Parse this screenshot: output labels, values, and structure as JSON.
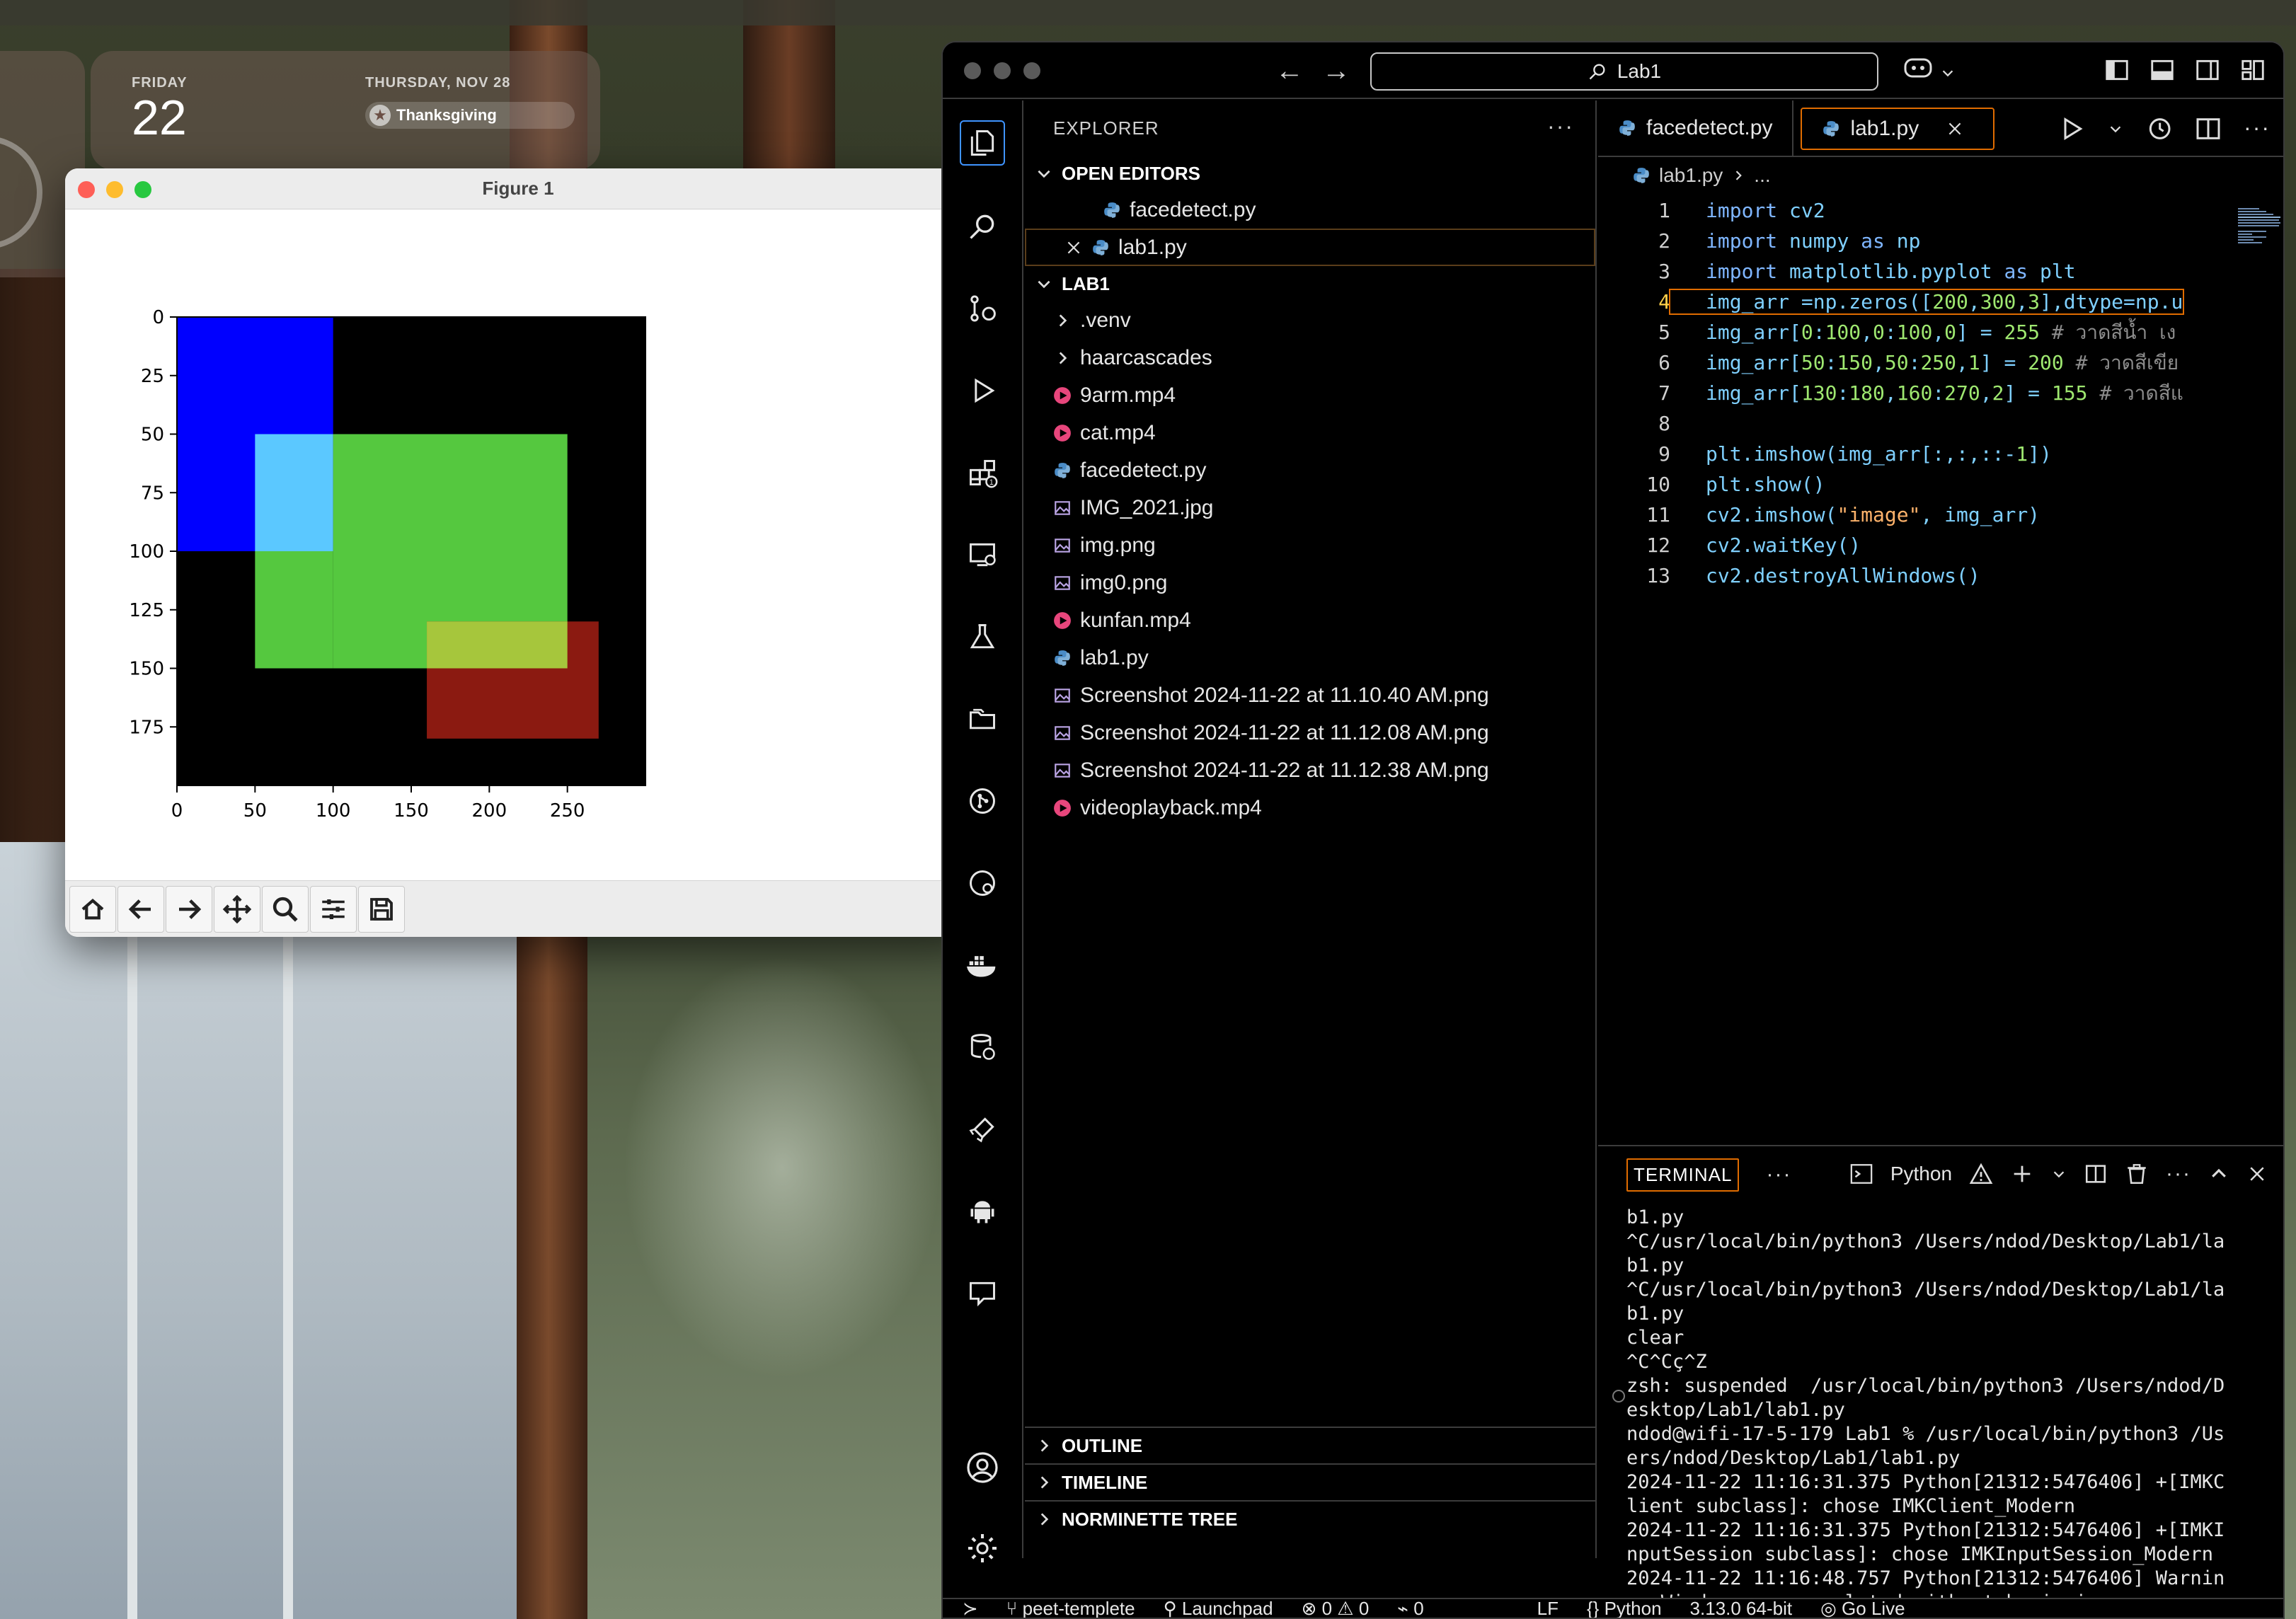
{
  "widget": {
    "day_name": "FRIDAY",
    "day_number": "22",
    "next_date": "THURSDAY, NOV 28",
    "event": "Thanksgiving"
  },
  "figure": {
    "title": "Figure 1",
    "chart_data": {
      "type": "heatmap",
      "title": "",
      "xlabel": "",
      "ylabel": "",
      "xlim": [
        0,
        300
      ],
      "ylim": [
        200,
        0
      ],
      "x_ticks": [
        "0",
        "50",
        "100",
        "150",
        "200",
        "250"
      ],
      "y_ticks": [
        "0",
        "25",
        "50",
        "75",
        "100",
        "125",
        "150",
        "175"
      ],
      "background": "#000000",
      "regions": [
        {
          "x": [
            0,
            100
          ],
          "y": [
            0,
            100
          ],
          "color": "#0000ff"
        },
        {
          "x": [
            50,
            100
          ],
          "y": [
            50,
            100
          ],
          "color": "#5bc8ff"
        },
        {
          "x": [
            100,
            250
          ],
          "y": [
            50,
            150
          ],
          "color": "#55c83f"
        },
        {
          "x": [
            50,
            100
          ],
          "y": [
            100,
            150
          ],
          "color": "#55c83f"
        },
        {
          "x": [
            160,
            270
          ],
          "y": [
            130,
            180
          ],
          "color": "#8b1a11"
        },
        {
          "x": [
            160,
            250
          ],
          "y": [
            130,
            150
          ],
          "color": "#a6c63c"
        }
      ]
    },
    "toolbar": [
      "home-icon",
      "back-icon",
      "forward-icon",
      "pan-icon",
      "zoom-icon",
      "configure-icon",
      "save-icon"
    ]
  },
  "vscode": {
    "search": "Lab1",
    "explorer_title": "EXPLORER",
    "open_editors_title": "OPEN EDITORS",
    "open_editors": [
      "facedetect.py",
      "lab1.py"
    ],
    "folder_title": "LAB1",
    "files": [
      {
        "name": ".venv",
        "kind": "folder"
      },
      {
        "name": "haarcascades",
        "kind": "folder"
      },
      {
        "name": "9arm.mp4",
        "kind": "video"
      },
      {
        "name": "cat.mp4",
        "kind": "video"
      },
      {
        "name": "facedetect.py",
        "kind": "python"
      },
      {
        "name": "IMG_2021.jpg",
        "kind": "image"
      },
      {
        "name": "img.png",
        "kind": "image"
      },
      {
        "name": "img0.png",
        "kind": "image"
      },
      {
        "name": "kunfan.mp4",
        "kind": "video"
      },
      {
        "name": "lab1.py",
        "kind": "python"
      },
      {
        "name": "Screenshot 2024-11-22 at 11.10.40 AM.png",
        "kind": "image"
      },
      {
        "name": "Screenshot 2024-11-22 at 11.12.08 AM.png",
        "kind": "image"
      },
      {
        "name": "Screenshot 2024-11-22 at 11.12.38 AM.png",
        "kind": "image"
      },
      {
        "name": "videoplayback.mp4",
        "kind": "video"
      }
    ],
    "bottom_sections": [
      "OUTLINE",
      "TIMELINE",
      "NORMINETTE TREE"
    ],
    "tabs": [
      "facedetect.py",
      "lab1.py"
    ],
    "breadcrumb": [
      "lab1.py",
      "..."
    ],
    "code": [
      "import cv2",
      "import numpy as np",
      "import matplotlib.pyplot as plt",
      "img_arr =np.zeros([200,300,3],dtype=np.u",
      "img_arr[0:100,0:100,0] = 255 # วาดสีน้ำ เง",
      "img_arr[50:150,50:250,1] = 200 # วาดสีเขีย",
      "img_arr[130:180,160:270,2] = 155 # วาดสีแ",
      "",
      "plt.imshow(img_arr[:,:,::-1])",
      "plt.show()",
      "cv2.imshow(\"image\", img_arr)",
      "cv2.waitKey()",
      "cv2.destroyAllWindows()"
    ],
    "current_line": 4,
    "panel_tab": "TERMINAL",
    "terminal_shell": "Python",
    "terminal": [
      "b1.py",
      "^C/usr/local/bin/python3 /Users/ndod/Desktop/Lab1/la",
      "b1.py",
      "^C/usr/local/bin/python3 /Users/ndod/Desktop/Lab1/la",
      "b1.py",
      "clear",
      "^C^Cç^Z",
      "zsh: suspended  /usr/local/bin/python3 /Users/ndod/D",
      "esktop/Lab1/lab1.py",
      "ndod@wifi-17-5-179 Lab1 % /usr/local/bin/python3 /Us",
      "ers/ndod/Desktop/Lab1/lab1.py",
      "2024-11-22 11:16:31.375 Python[21312:5476406] +[IMKC",
      "lient subclass]: chose IMKClient_Modern",
      "2024-11-22 11:16:31.375 Python[21312:5476406] +[IMKI",
      "nputSession subclass]: chose IMKInputSession_Modern",
      "2024-11-22 11:16:48.757 Python[21312:5476406] Warnin",
      "g: Window move completed without beginning"
    ],
    "status": {
      "branch": "peet-templete",
      "launchpad": "Launchpad",
      "problems": "0",
      "warnings": "0",
      "ports": "0",
      "eol": "LF",
      "language": "Python",
      "interpreter": "3.13.0 64-bit",
      "golive": "Go Live"
    }
  }
}
